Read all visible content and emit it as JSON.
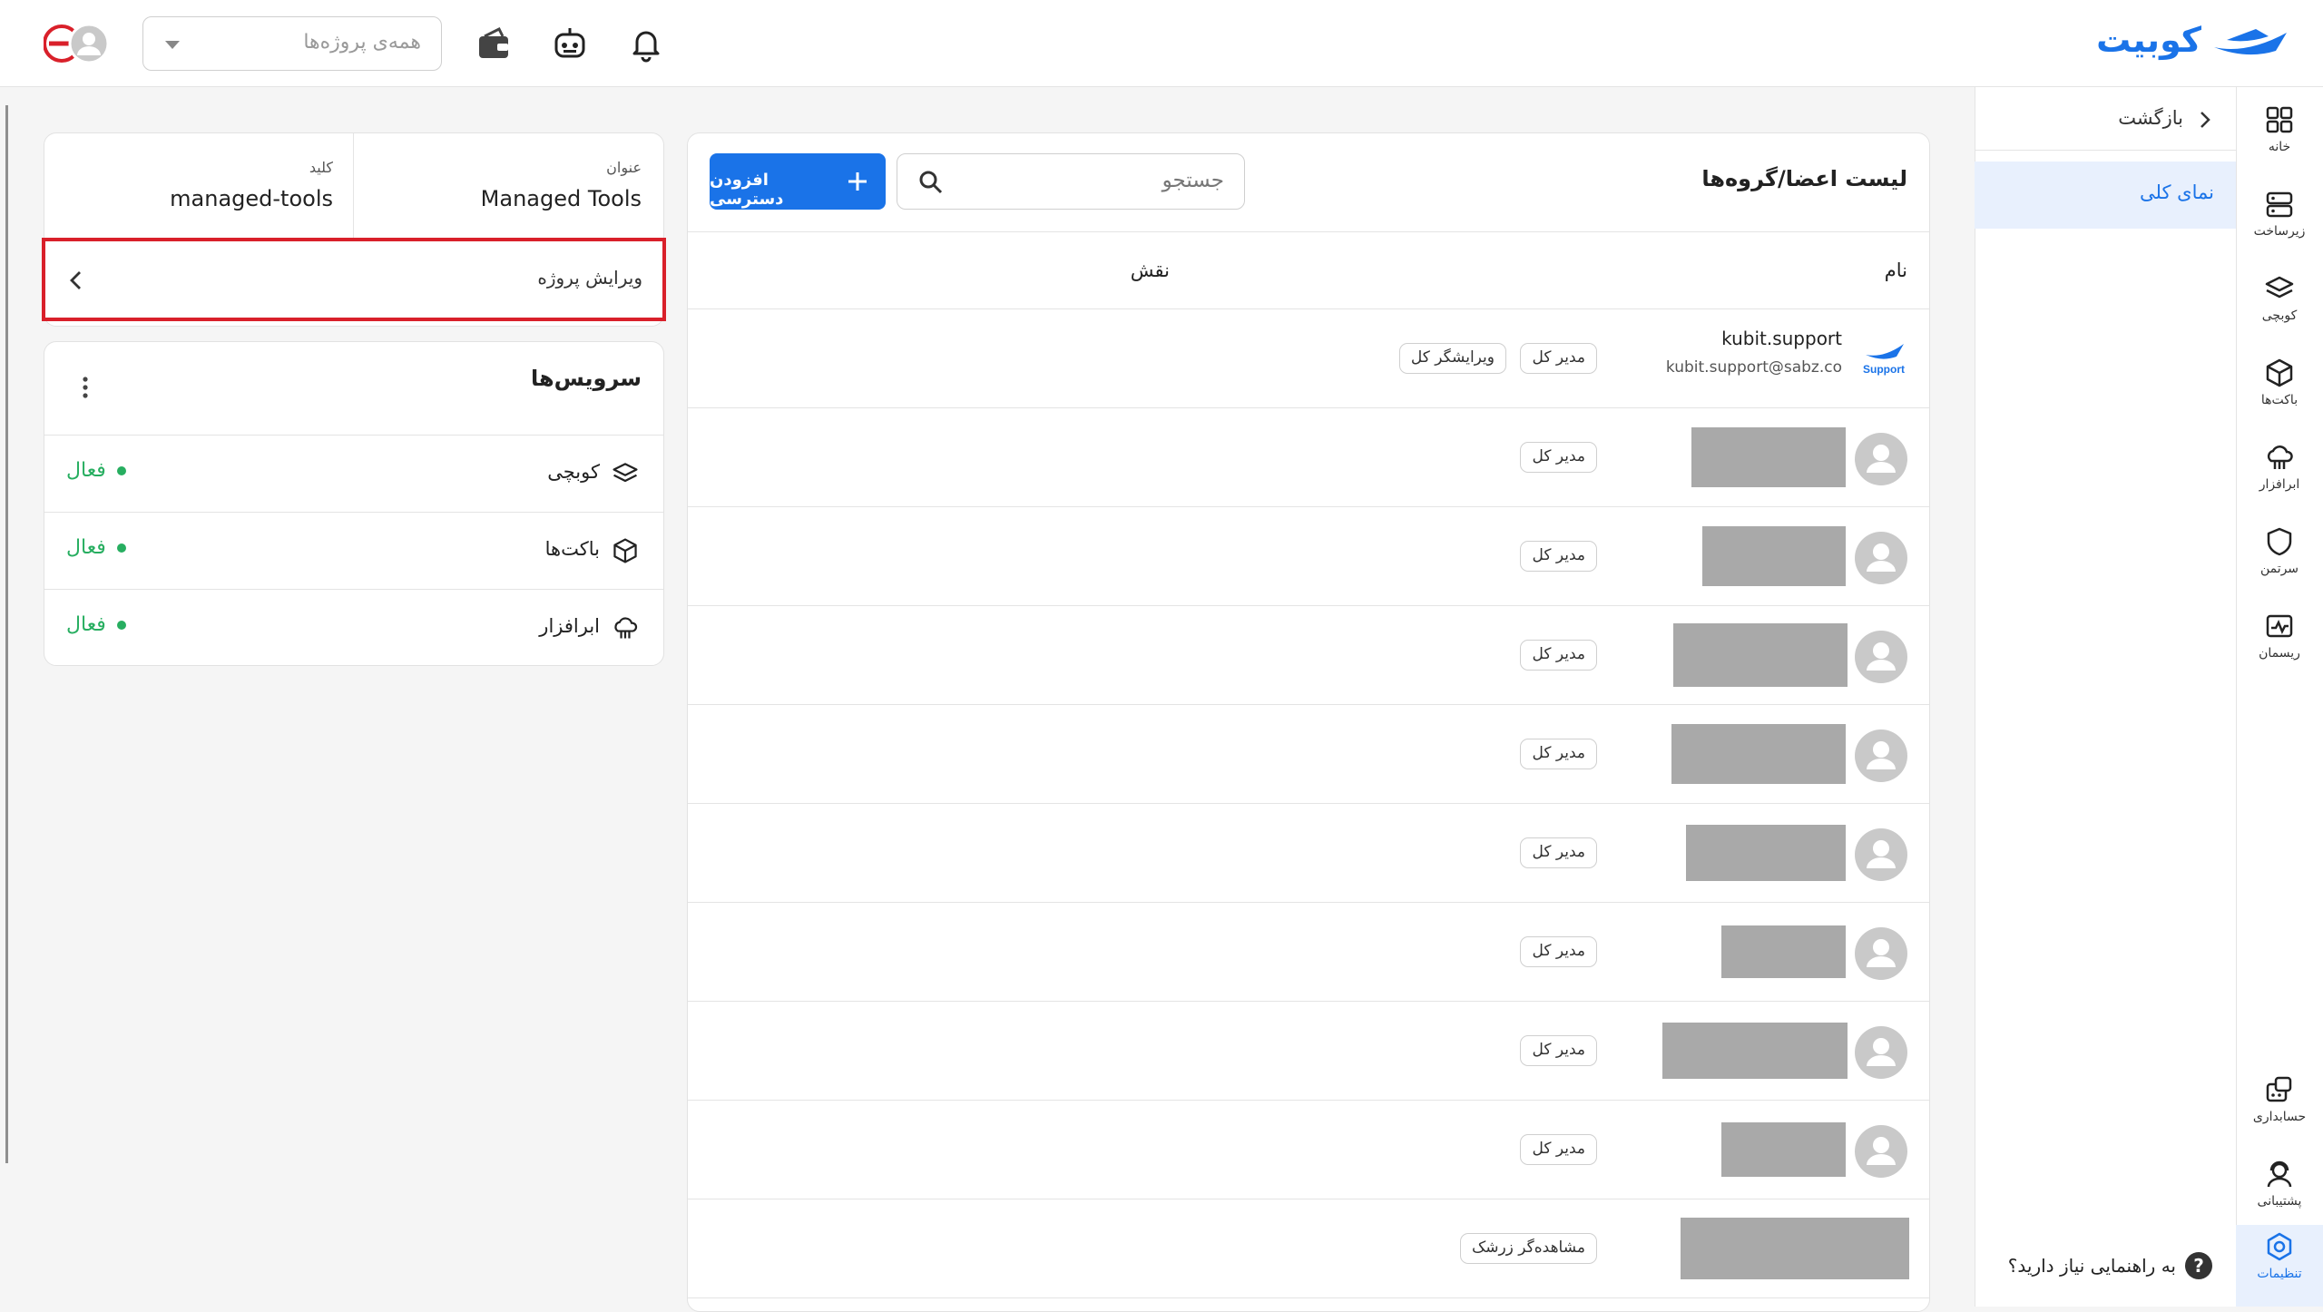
{
  "brand": {
    "name": "کوبیت"
  },
  "topbar": {
    "project_select_placeholder": "همه‌ی پروژه‌ها"
  },
  "rail": {
    "items": [
      {
        "label": "خانه",
        "icon": "grid-icon"
      },
      {
        "label": "زیرساخت",
        "icon": "server-icon"
      },
      {
        "label": "کوبچی",
        "icon": "layers-icon"
      },
      {
        "label": "باکت‌ها",
        "icon": "cube-icon"
      },
      {
        "label": "ابرافزار",
        "icon": "cloud-tool-icon"
      },
      {
        "label": "سرتمن",
        "icon": "shield-icon"
      },
      {
        "label": "ریسمان",
        "icon": "monitor-icon"
      },
      {
        "label": "حسابداری",
        "icon": "calculator-icon"
      },
      {
        "label": "پشتیبانی",
        "icon": "headset-icon"
      },
      {
        "label": "تنظیمات",
        "icon": "settings-icon"
      }
    ]
  },
  "subnav": {
    "back_label": "بازگشت",
    "overview_label": "نمای کلی",
    "help_label": "به راهنمایی نیاز دارید؟"
  },
  "members": {
    "title": "لیست اعضا/گروه‌ها",
    "search_placeholder": "جستجو",
    "add_button": "افزودن دسترسی",
    "col_name": "نام",
    "col_role": "نقش",
    "support_user": {
      "name": "kubit.support",
      "email": "kubit.support@sabz.co",
      "logo_text": "Support",
      "roles": [
        "مدیر کل",
        "ویرایشگر کل"
      ]
    },
    "rows": [
      {
        "role": "مدیر کل"
      },
      {
        "role": "مدیر کل"
      },
      {
        "role": "مدیر کل"
      },
      {
        "role": "مدیر کل"
      },
      {
        "role": "مدیر کل"
      },
      {
        "role": "مدیر کل"
      },
      {
        "role": "مدیر کل"
      },
      {
        "role": "مدیر کل"
      },
      {
        "role": "مشاهده‌گر زرشک"
      }
    ]
  },
  "project": {
    "title_label": "عنوان",
    "title_value": "Managed Tools",
    "key_label": "کلید",
    "key_value": "managed-tools",
    "edit_label": "ویرایش پروژه"
  },
  "services": {
    "title": "سرویس‌ها",
    "items": [
      {
        "name": "کوبچی",
        "status": "فعال",
        "icon": "layers-icon"
      },
      {
        "name": "باکت‌ها",
        "status": "فعال",
        "icon": "cube-icon"
      },
      {
        "name": "ابرافزار",
        "status": "فعال",
        "icon": "cloud-tool-icon"
      }
    ]
  },
  "colors": {
    "accent": "#1a73e8",
    "active": "#27ae60",
    "highlight_border": "#d9202a"
  }
}
